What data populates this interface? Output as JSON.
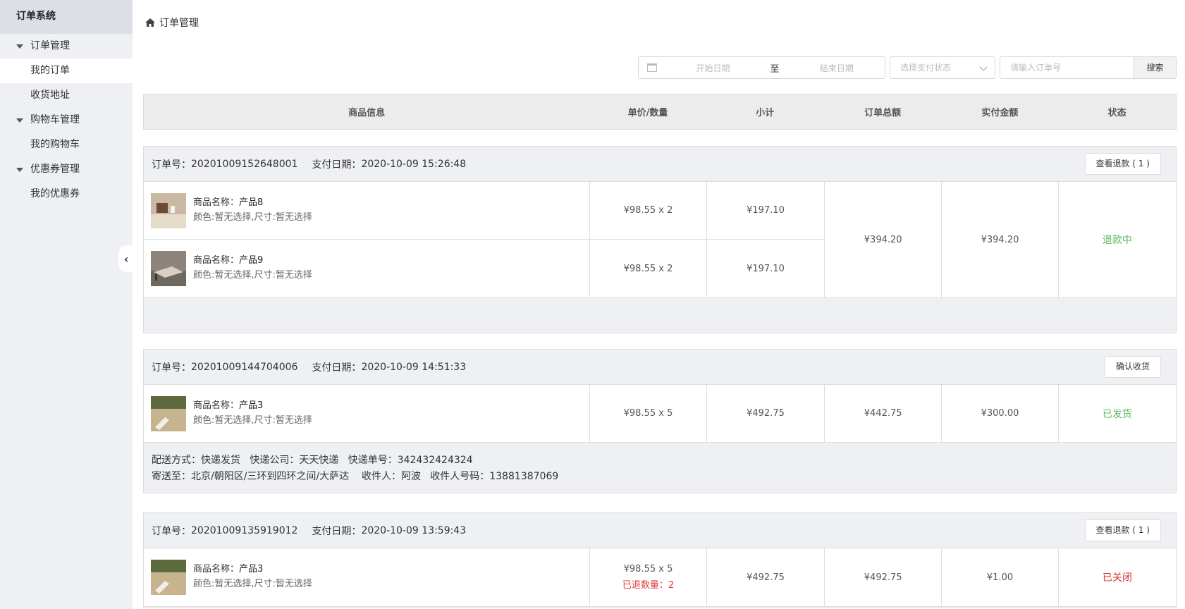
{
  "sidebar": {
    "title": "订单系统",
    "groups": [
      {
        "label": "订单管理",
        "items": [
          "我的订单",
          "收货地址"
        ]
      },
      {
        "label": "购物车管理",
        "items": [
          "我的购物车"
        ]
      },
      {
        "label": "优惠券管理",
        "items": [
          "我的优惠券"
        ]
      }
    ],
    "active_item": "我的订单"
  },
  "breadcrumb": {
    "label": "订单管理"
  },
  "search": {
    "start_placeholder": "开始日期",
    "separator": "至",
    "end_placeholder": "结束日期",
    "status_placeholder": "选择支付状态",
    "order_placeholder": "请输入订单号",
    "button": "搜索"
  },
  "table_headers": [
    "商品信息",
    "单价/数量",
    "小计",
    "订单总额",
    "实付金额",
    "状态"
  ],
  "labels": {
    "order_no": "订单号：",
    "pay_date": "支付日期：",
    "product_name": "商品名称：",
    "spec": "颜色:暂无选择,尺寸:暂无选择"
  },
  "orders": [
    {
      "order_no": "20201009152648001",
      "pay_date": "2020-10-09 15:26:48",
      "action": "查看退款 ( 1 )",
      "products": [
        {
          "name": "产品8",
          "price_qty": "¥98.55 x 2",
          "subtotal": "¥197.10"
        },
        {
          "name": "产品9",
          "price_qty": "¥98.55 x 2",
          "subtotal": "¥197.10"
        }
      ],
      "total": "¥394.20",
      "paid": "¥394.20",
      "status": "退款中",
      "status_color": "#5cb85c"
    },
    {
      "order_no": "20201009144704006",
      "pay_date": "2020-10-09 14:51:33",
      "action": "确认收货",
      "products": [
        {
          "name": "产品3",
          "price_qty": "¥98.55 x 5",
          "subtotal": "¥492.75"
        }
      ],
      "total": "¥442.75",
      "paid": "¥300.00",
      "status": "已发货",
      "status_color": "#5cb85c",
      "shipping": {
        "line1": "配送方式：快递发货   快递公司：天天快递   快递单号：342432424324",
        "line2": "寄送至：北京/朝阳区/三环到四环之间/大萨达    收件人：阿波   收件人号码：13881387069"
      }
    },
    {
      "order_no": "20201009135919012",
      "pay_date": "2020-10-09 13:59:43",
      "action": "查看退款 ( 1 )",
      "products": [
        {
          "name": "产品3",
          "price_qty": "¥98.55 x 5",
          "refund": "已退数量：2",
          "subtotal": "¥492.75"
        }
      ],
      "total": "¥492.75",
      "paid": "¥1.00",
      "status": "已关闭",
      "status_color": "#d9302d"
    }
  ]
}
